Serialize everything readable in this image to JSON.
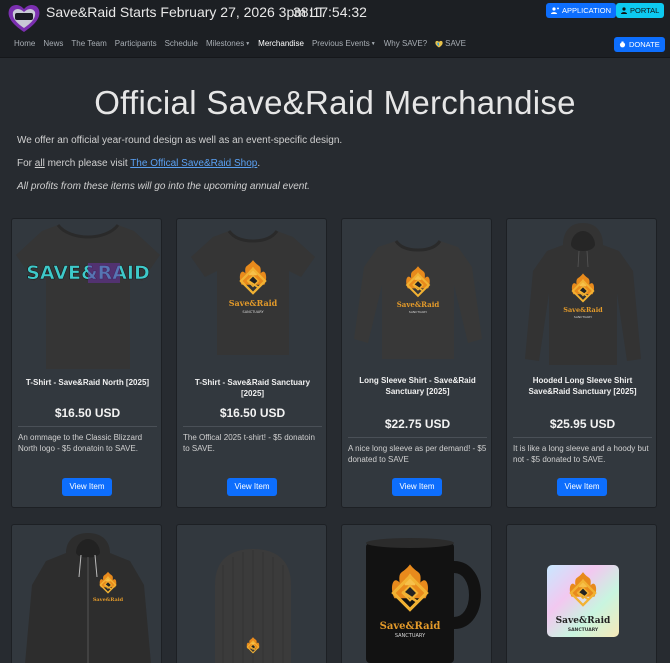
{
  "header": {
    "banner": "Save&Raid Starts February 27, 2026 3pm LT",
    "countdown": "38:17:54:32",
    "application_label": "APPLICATION",
    "portal_label": "PORTAL",
    "donate_label": "DONATE"
  },
  "nav": {
    "items": [
      {
        "label": "Home"
      },
      {
        "label": "News"
      },
      {
        "label": "The Team"
      },
      {
        "label": "Participants"
      },
      {
        "label": "Schedule"
      },
      {
        "label": "Milestones"
      },
      {
        "label": "Merchandise"
      },
      {
        "label": "Previous Events"
      },
      {
        "label": "Why SAVE?"
      },
      {
        "label": "SAVE"
      }
    ]
  },
  "page": {
    "title": "Official Save&Raid Merchandise",
    "intro1": "We offer an official year-round design as well as an event-specific design.",
    "intro2_prefix": "For ",
    "intro2_all": "all",
    "intro2_mid": " merch please visit ",
    "intro2_link": "The Offical Save&Raid Shop",
    "intro2_suffix": ".",
    "intro3": "All profits from these items will go into the upcoming annual event."
  },
  "products": [
    {
      "name": "T-Shirt - Save&Raid North [2025]",
      "price": "$16.50 USD",
      "desc": "An ommage to the Classic Blizzard North logo - $5 donatoin to SAVE.",
      "button": "View Item"
    },
    {
      "name": "T-Shirt - Save&Raid Sanctuary [2025]",
      "price": "$16.50 USD",
      "desc": "The Offical 2025 t-shirt! - $5 donatoin to SAVE.",
      "button": "View Item"
    },
    {
      "name": "Long Sleeve Shirt - Save&Raid Sanctuary [2025]",
      "price": "$22.75 USD",
      "desc": "A nice long sleeve as per demand! - $5 donated to SAVE",
      "button": "View Item"
    },
    {
      "name": "Hooded Long Sleeve Shirt Save&Raid Sanctuary [2025]",
      "price": "$25.95 USD",
      "desc": "It is like a long sleeve and a hoody but not - $5 donated to SAVE.",
      "button": "View Item"
    }
  ],
  "shirt_north_logo": "SAVE&RAID",
  "sanctuary_logo_top": "Save&Raid",
  "sanctuary_logo_bottom": "SANCTUARY",
  "colors": {
    "background": "#272b30",
    "navbar": "#1c1f23",
    "card": "#32383e",
    "primary": "#0d6efd",
    "info": "#0dcaf0",
    "link": "#5aa0f2"
  }
}
